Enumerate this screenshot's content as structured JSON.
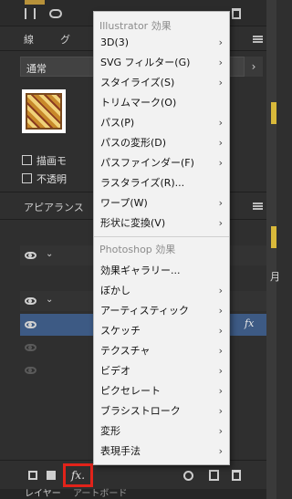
{
  "panels": {
    "tab_line": "線",
    "tab_partial": "グ",
    "blend_mode": "通常",
    "checkbox_draw": "描画モ",
    "checkbox_opacity": "不透明",
    "appearance_title": "アピアランス",
    "fx_row_label": "fx",
    "bottom_tab_layers": "レイヤー",
    "bottom_tab_artboards": "アートボード",
    "edge_char": "月"
  },
  "menu": {
    "illustrator_header": "Illustrator 効果",
    "illustrator_items": [
      {
        "label": "3D(3)",
        "submenu": true
      },
      {
        "label": "SVG フィルター(G)",
        "submenu": true
      },
      {
        "label": "スタイライズ(S)",
        "submenu": true
      },
      {
        "label": "トリムマーク(O)",
        "submenu": false
      },
      {
        "label": "パス(P)",
        "submenu": true
      },
      {
        "label": "パスの変形(D)",
        "submenu": true
      },
      {
        "label": "パスファインダー(F)",
        "submenu": true
      },
      {
        "label": "ラスタライズ(R)...",
        "submenu": false
      },
      {
        "label": "ワープ(W)",
        "submenu": true
      },
      {
        "label": "形状に変換(V)",
        "submenu": true
      }
    ],
    "photoshop_header": "Photoshop 効果",
    "photoshop_items": [
      {
        "label": "効果ギャラリー...",
        "submenu": false
      },
      {
        "label": "ぼかし",
        "submenu": true
      },
      {
        "label": "アーティスティック",
        "submenu": true
      },
      {
        "label": "スケッチ",
        "submenu": true
      },
      {
        "label": "テクスチャ",
        "submenu": true
      },
      {
        "label": "ビデオ",
        "submenu": true
      },
      {
        "label": "ピクセレート",
        "submenu": true
      },
      {
        "label": "ブラシストローク",
        "submenu": true
      },
      {
        "label": "変形",
        "submenu": true
      },
      {
        "label": "表現手法",
        "submenu": true
      }
    ]
  },
  "icons": {
    "submenu_arrow": "›",
    "fx_button": "fx."
  },
  "colors": {
    "highlight_border": "#e2231a",
    "selected_row": "#3d5a84",
    "menu_bg": "#f2f2f2"
  }
}
